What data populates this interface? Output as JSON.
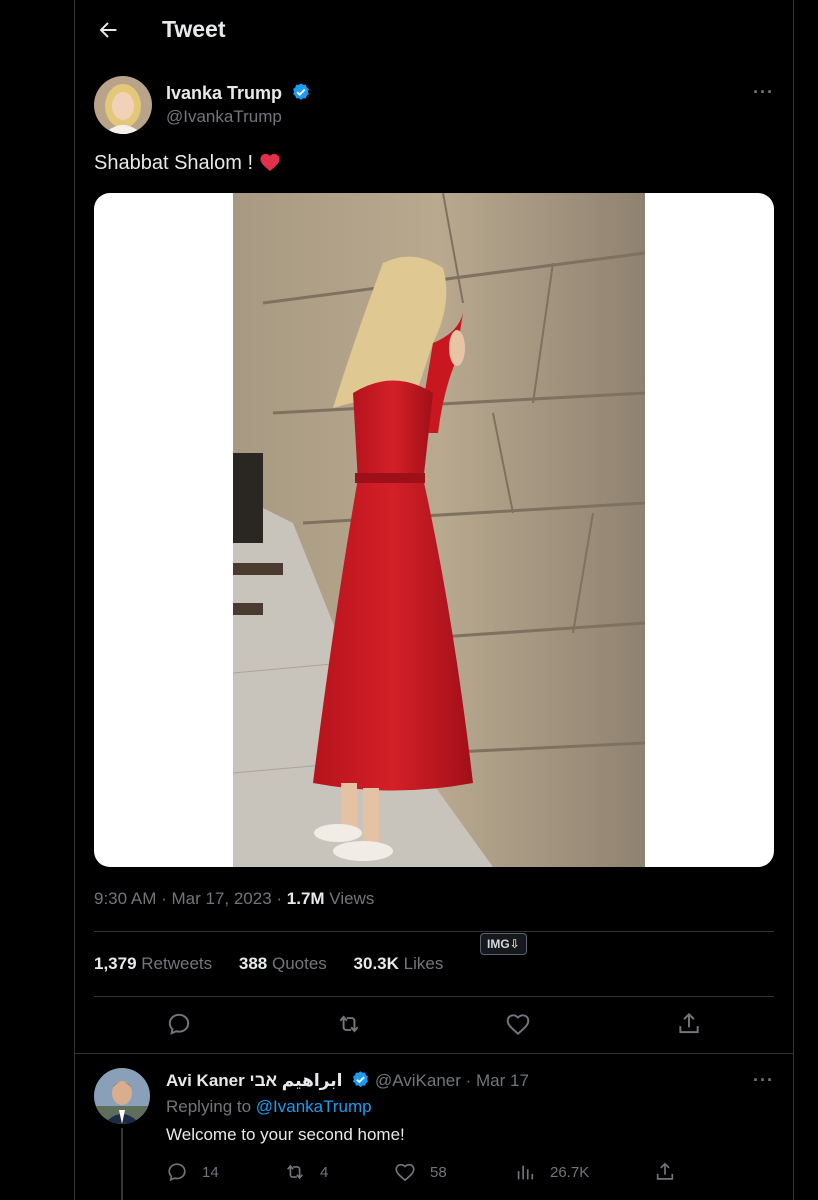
{
  "header": {
    "title": "Tweet",
    "back_icon": "arrow-left-icon"
  },
  "tweet": {
    "author_name": "Ivanka Trump",
    "author_handle": "@IvankaTrump",
    "text": "Shabbat Shalom ! ",
    "emoji": "❤️",
    "time": "9:30 AM · Mar 17, 2023 · ",
    "views_count": "1.7M",
    "views_label": " Views",
    "retweets_count": "1,379",
    "retweets_label": " Retweets",
    "quotes_count": "388",
    "quotes_label": " Quotes",
    "likes_count": "30.3K",
    "likes_label": " Likes",
    "badge": "IMG⇩",
    "more": "···"
  },
  "reply": {
    "author_name": "Avi Kaner ابراهيم אבי",
    "author_handle": "@AviKaner",
    "date": " · Mar 17",
    "replying_prefix": "Replying to ",
    "replying_handle": "@IvankaTrump",
    "text": "Welcome to your second home!",
    "reply_count": "14",
    "retweet_count": "4",
    "like_count": "58",
    "views_count": "26.7K",
    "more": "···"
  },
  "colors": {
    "background": "#000000",
    "text": "#e7e9ea",
    "muted": "#71767b",
    "accent": "#1d9bf0",
    "divider": "#2f3336",
    "heart": "#f91880"
  }
}
